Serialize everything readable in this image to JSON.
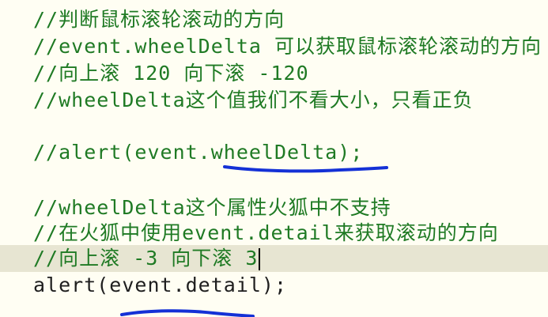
{
  "editor": {
    "lines": [
      {
        "text": "//判断鼠标滚轮滚动的方向"
      },
      {
        "text": "//event.wheelDelta 可以获取鼠标滚轮滚动的方向"
      },
      {
        "text": "//向上滚 120 向下滚 -120"
      },
      {
        "text": "//wheelDelta这个值我们不看大小，只看正负"
      },
      {
        "text": ""
      },
      {
        "text": "//alert(event.wheelDelta);"
      },
      {
        "text": ""
      },
      {
        "text": "//wheelDelta这个属性火狐中不支持"
      },
      {
        "text": "//在火狐中使用event.detail来获取滚动的方向"
      },
      {
        "text": "//向上滚 -3 向下滚 3"
      },
      {
        "text": "alert(event.detail);"
      }
    ]
  },
  "colors": {
    "background": "#fffef3",
    "comment": "#1f7a24",
    "code": "#1e1e1e",
    "current_line": "#e7e5d2",
    "annotation_ink": "#1431d6"
  }
}
